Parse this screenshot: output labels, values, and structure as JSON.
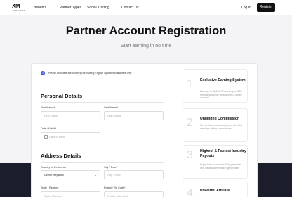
{
  "nav": {
    "logo_text": "XM",
    "logo_sub": "PARTNERS",
    "items": [
      {
        "label": "Benefits",
        "has_dropdown": true
      },
      {
        "label": "Partner Types",
        "has_dropdown": false
      },
      {
        "label": "Social Trading",
        "has_dropdown": true
      },
      {
        "label": "Contact Us",
        "has_dropdown": false
      }
    ],
    "login_label": "Log In",
    "register_label": "Register"
  },
  "header": {
    "title": "Partner Account Registration",
    "subtitle": "Start earning in no time"
  },
  "form": {
    "notice": "Please complete the following form using English alphabet characters only.",
    "personal": {
      "title": "Personal Details",
      "first_name_label": "First Name*",
      "first_name_placeholder": "First Name",
      "last_name_label": "Last Name*",
      "last_name_placeholder": "Last Name",
      "dob_label": "Date of birth*",
      "dob_placeholder": "Date of birth"
    },
    "address": {
      "title": "Address Details",
      "country_label": "Country of Residence*",
      "country_value": "Czech Republic",
      "city_label": "City / Town*",
      "city_placeholder": "City / Town",
      "state_label": "State / Region*",
      "state_placeholder": "State / Region",
      "postal_label": "Postal / Zip Code*",
      "postal_placeholder": "Postal / Zip Code"
    }
  },
  "steps": [
    {
      "number": "1",
      "title": "Exclusive Earning System",
      "desc": "Earn up to $1,500 CPA and up to $80 referral share on spread from a single account."
    },
    {
      "number": "2",
      "title": "Unlimited Commission",
      "desc": "Get limitless commission per client for earnings without restrictions."
    },
    {
      "number": "3",
      "title": "Highest & Fastest Industry Payouts",
      "desc": "Enjoy fully automated daily payments and instant commission generation."
    },
    {
      "number": "4",
      "title": "Powerful Affiliate",
      "desc": ""
    }
  ],
  "colors": {
    "accent": "#3b5ad6",
    "footer_dark": "#1b1d2a",
    "register_button": "#111111"
  }
}
